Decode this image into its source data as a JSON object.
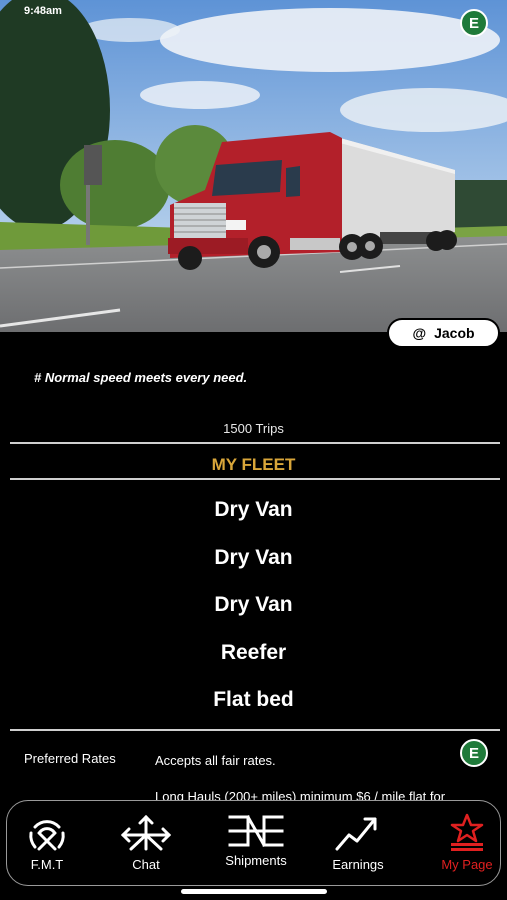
{
  "status_bar": {
    "time": "9:48am"
  },
  "badge": {
    "letter": "E",
    "color": "#1f7a3a"
  },
  "user": {
    "at": "@",
    "name": "Jacob"
  },
  "profile": {
    "tagline": "# Normal speed meets every need.",
    "trips": "1500 Trips"
  },
  "fleet": {
    "title": "MY FLEET",
    "title_color": "#d9a63a",
    "items": [
      "Dry Van",
      "Dry Van",
      "Dry Van",
      "Reefer",
      "Flat bed"
    ]
  },
  "rates": {
    "label": "Preferred Rates",
    "value": "Accepts all fair rates.",
    "detail": "Long Hauls (200+ miles) minimum $6 / mile flat for"
  },
  "tabs": [
    {
      "label": "F.M.T",
      "icon": "fmt-signal-icon"
    },
    {
      "label": "Chat",
      "icon": "chat-arrows-icon"
    },
    {
      "label": "Shipments",
      "icon": "shipments-icon"
    },
    {
      "label": "Earnings",
      "icon": "earnings-trend-icon"
    },
    {
      "label": "My Page",
      "icon": "my-page-star-icon",
      "active": true,
      "active_color": "#e02020"
    }
  ]
}
